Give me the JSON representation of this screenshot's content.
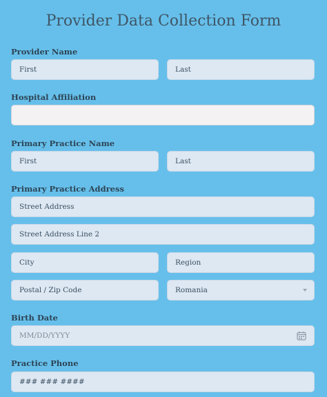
{
  "form": {
    "title": "Provider Data Collection Form",
    "provider_name": {
      "label": "Provider Name",
      "first": "First",
      "last": "Last"
    },
    "hospital_affiliation": {
      "label": "Hospital Affiliation",
      "value": ""
    },
    "primary_practice_name": {
      "label": "Primary Practice Name",
      "first": "First",
      "last": "Last"
    },
    "primary_practice_address": {
      "label": "Primary Practice Address",
      "street": "Street Address",
      "street2": "Street Address Line 2",
      "city": "City",
      "region": "Region",
      "postal": "Postal / Zip Code",
      "country": "Romania"
    },
    "birth_date": {
      "label": "Birth Date",
      "placeholder": "MM/DD/YYYY"
    },
    "practice_phone": {
      "label": "Practice Phone",
      "placeholder": "### ### ####"
    }
  },
  "icons": {
    "date": "calendar-icon",
    "country_select": "chevron-down-icon"
  },
  "colors": {
    "background": "#66bfea",
    "field": "#dde8f3",
    "field_white": "#f5f2f4"
  }
}
